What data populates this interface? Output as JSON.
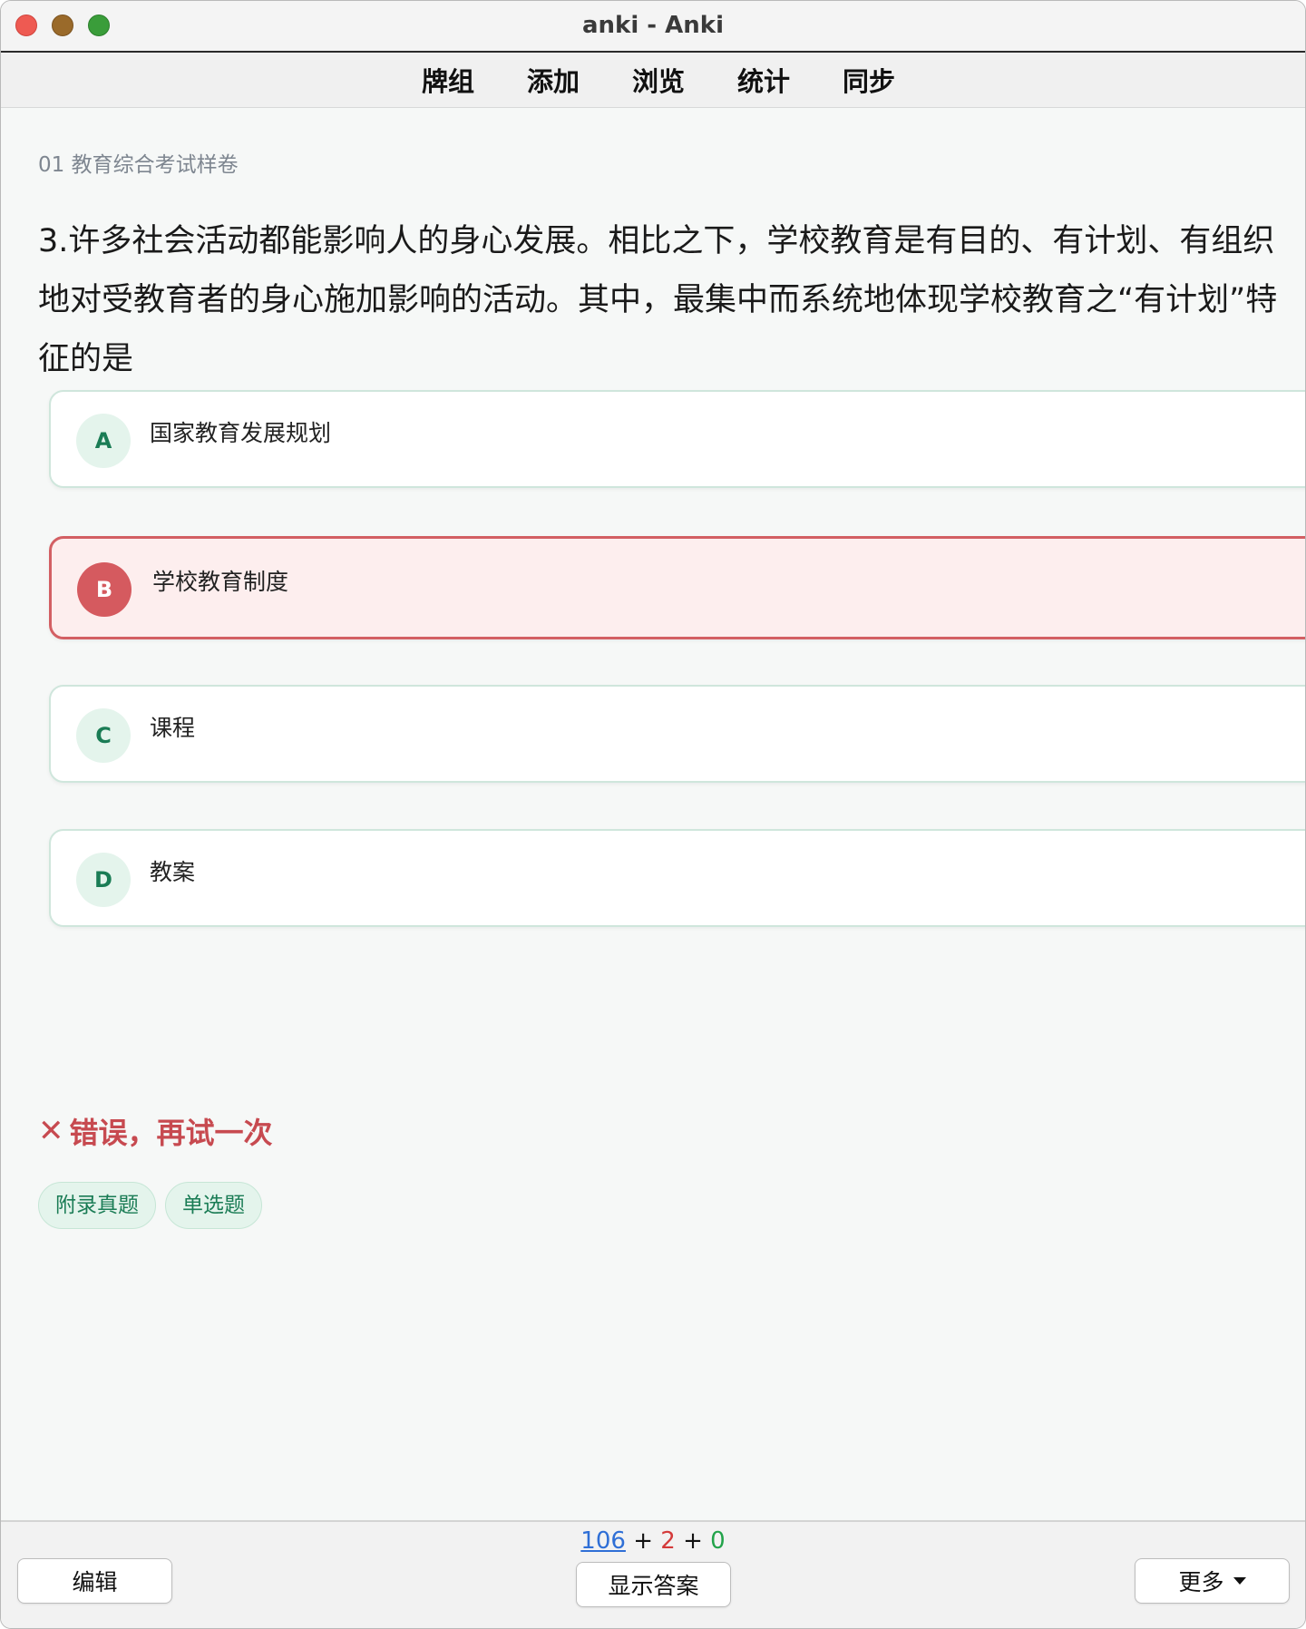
{
  "window": {
    "title": "anki - Anki"
  },
  "toolbar": {
    "items": [
      {
        "label": "牌组"
      },
      {
        "label": "添加"
      },
      {
        "label": "浏览"
      },
      {
        "label": "统计"
      },
      {
        "label": "同步"
      }
    ]
  },
  "card": {
    "deck_name": "01 教育综合考试样卷",
    "question": "3.许多社会活动都能影响人的身心发展。相比之下，学校教育是有目的、有计划、有组织地对受教育者的身心施加影响的活动。其中，最集中而系统地体现学校教育之“有计划”特征的是",
    "options": [
      {
        "letter": "A",
        "text": "国家教育发展规划",
        "state": "normal"
      },
      {
        "letter": "B",
        "text": "学校教育制度",
        "state": "wrong"
      },
      {
        "letter": "C",
        "text": "课程",
        "state": "normal"
      },
      {
        "letter": "D",
        "text": "教案",
        "state": "normal"
      }
    ],
    "feedback": {
      "icon": "✕",
      "text": "错误，再试一次",
      "color": "#c74a50"
    },
    "tags": [
      "附录真题",
      "单选题"
    ]
  },
  "bottom": {
    "edit_label": "编辑",
    "show_answer_label": "显示答案",
    "more_label": "更多",
    "counts": {
      "new": "106",
      "learn": "2",
      "review": "0",
      "sep": "+"
    }
  },
  "colors": {
    "accent_green": "#1a7c55",
    "wrong_red": "#d55a5f",
    "new_blue": "#2f6fd6",
    "learn_red": "#d43a3a",
    "review_green": "#22a34a"
  }
}
